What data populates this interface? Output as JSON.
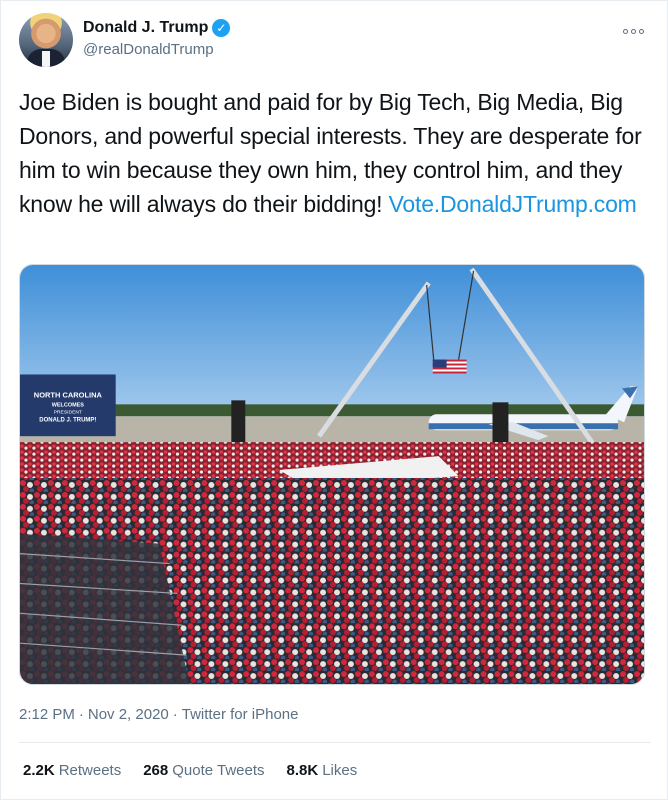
{
  "author": {
    "display_name": "Donald J. Trump",
    "handle": "@realDonaldTrump",
    "verified_icon": "✓"
  },
  "tweet": {
    "text": "Joe Biden is bought and paid for by Big Tech, Big Media, Big Donors, and powerful special interests. They are desperate for him to win because they own him, they control him, and they know he will always do their bidding!",
    "link": "Vote.DonaldJTrump.com"
  },
  "media": {
    "sign_lines": [
      "NORTH CAROLINA",
      "WELCOMES",
      "PRESIDENT",
      "DONALD J. TRUMP!"
    ],
    "colors": {
      "sky": "#4f9fe0",
      "crowd_red": "#c8253a",
      "grass": "#7aa653"
    }
  },
  "meta": {
    "time": "2:12 PM",
    "separator": "·",
    "date": "Nov 2, 2020",
    "source": "Twitter for iPhone"
  },
  "stats": {
    "retweets_count": "2.2K",
    "retweets_label": "Retweets",
    "quotes_count": "268",
    "quotes_label": "Quote Tweets",
    "likes_count": "8.8K",
    "likes_label": "Likes"
  }
}
